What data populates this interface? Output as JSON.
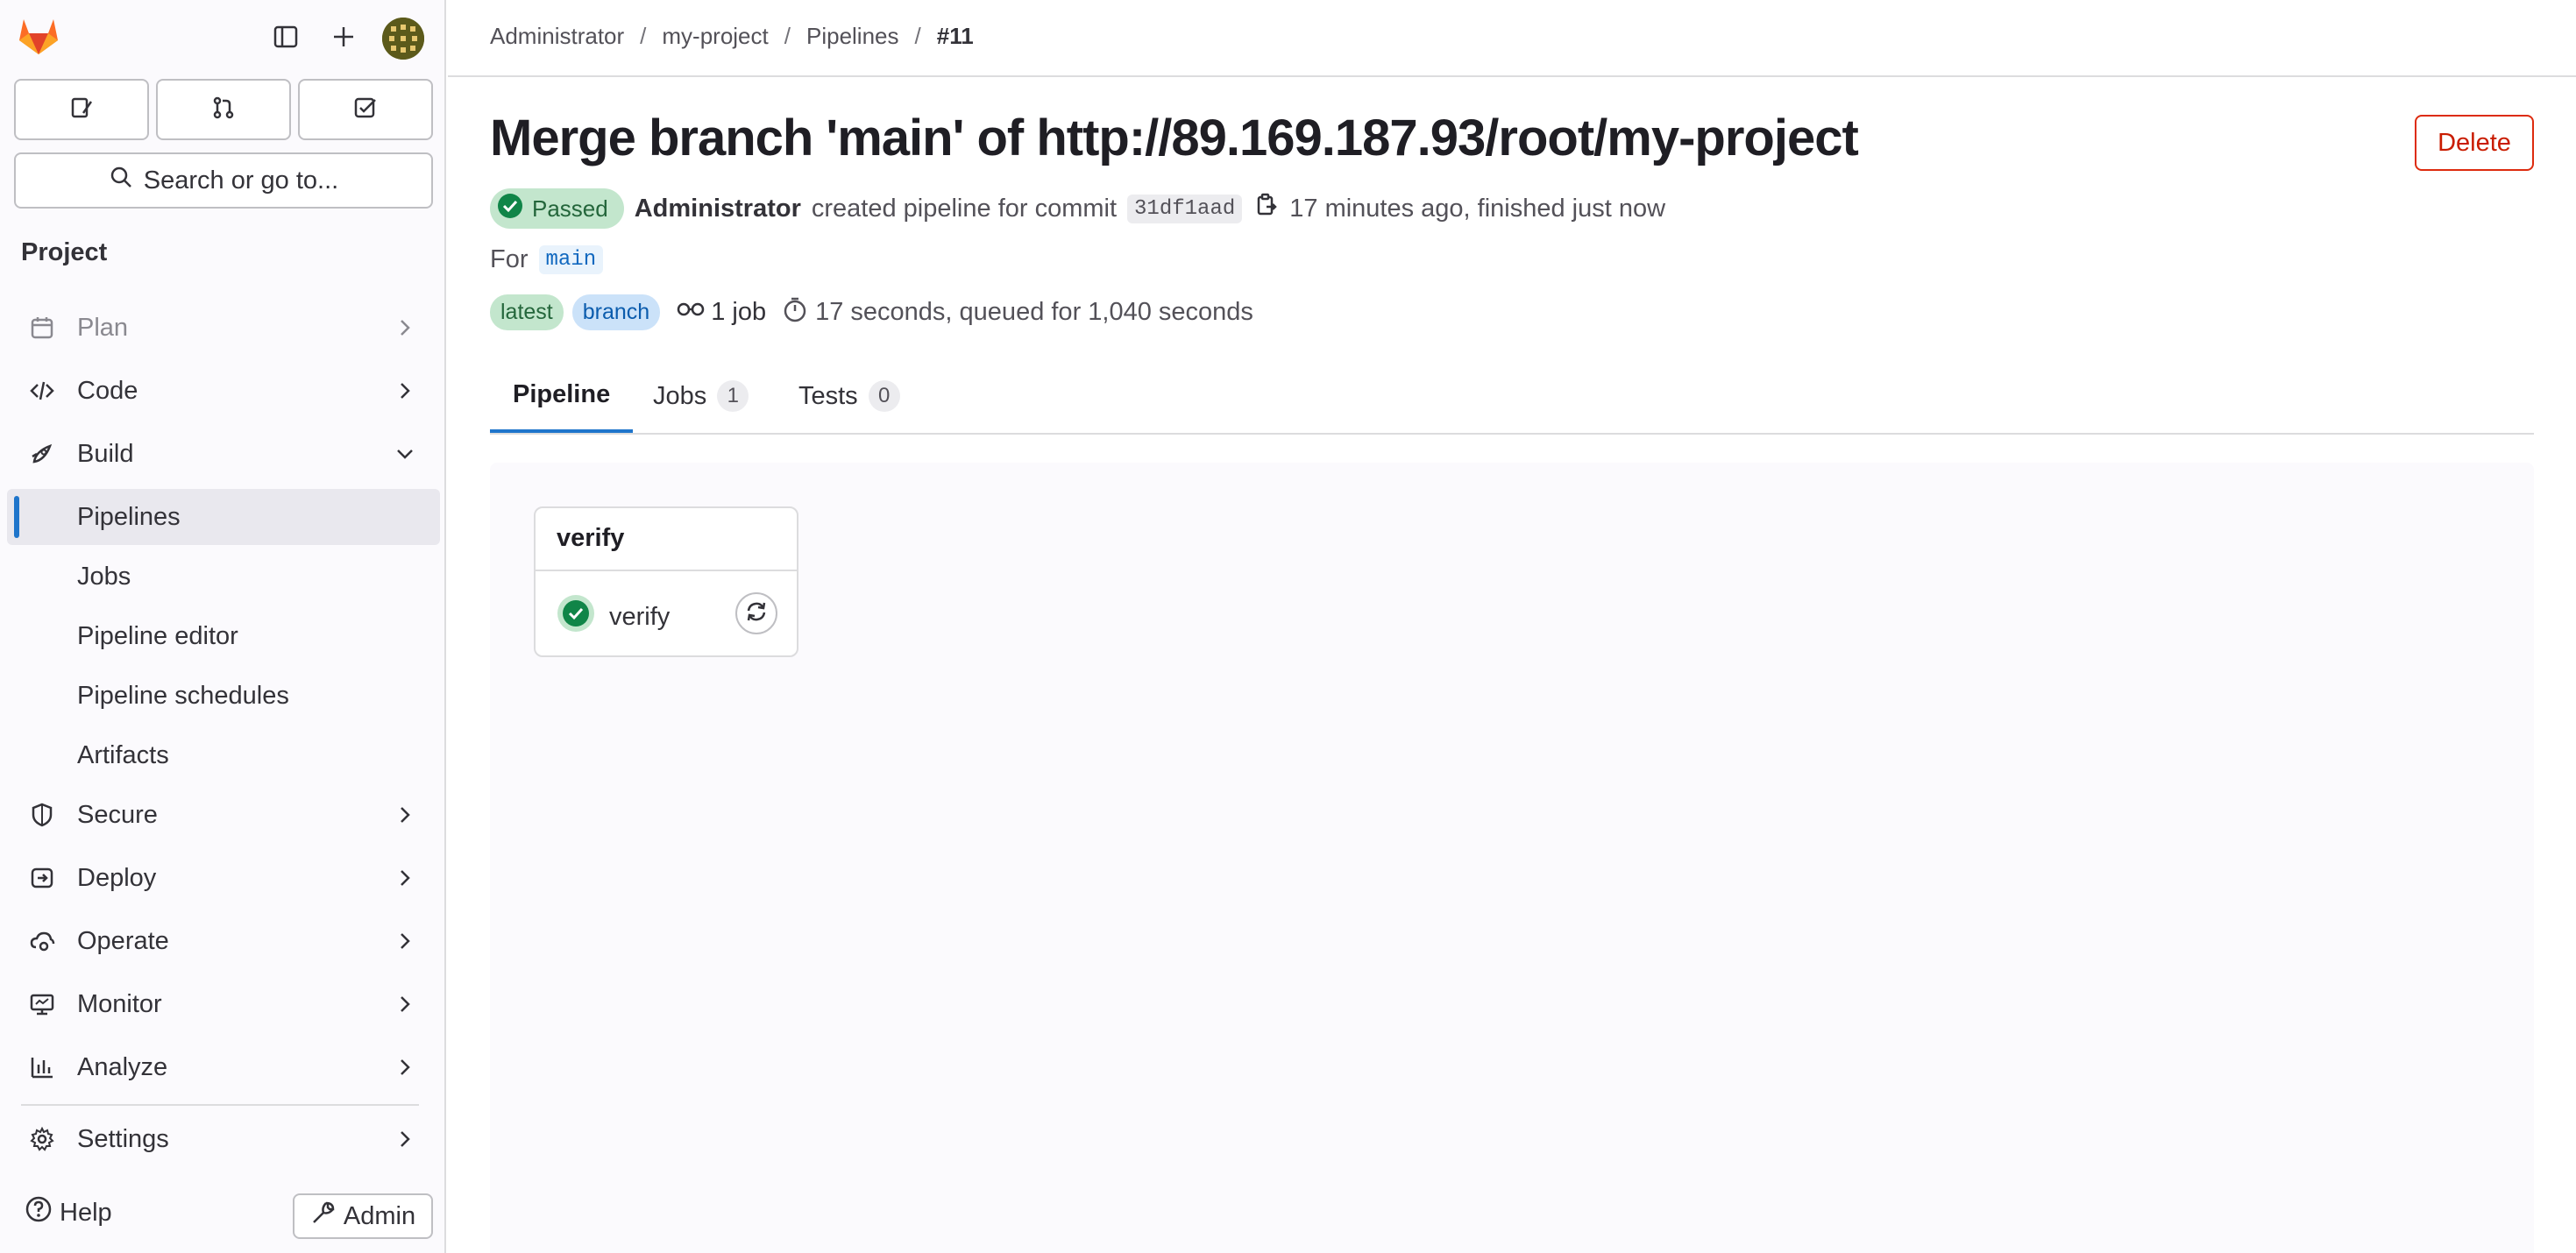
{
  "sidebar": {
    "search_label": "Search or go to...",
    "section_title": "Project",
    "nav": {
      "plan": "Plan",
      "code": "Code",
      "build": "Build",
      "secure": "Secure",
      "deploy": "Deploy",
      "operate": "Operate",
      "monitor": "Monitor",
      "analyze": "Analyze",
      "settings": "Settings"
    },
    "build_items": {
      "pipelines": "Pipelines",
      "jobs": "Jobs",
      "pipeline_editor": "Pipeline editor",
      "pipeline_schedules": "Pipeline schedules",
      "artifacts": "Artifacts"
    },
    "help_label": "Help",
    "admin_label": "Admin"
  },
  "breadcrumb": {
    "items": [
      "Administrator",
      "my-project",
      "Pipelines",
      "#11"
    ],
    "separator": "/"
  },
  "header": {
    "title": "Merge branch 'main' of http://89.169.187.93/root/my-project",
    "delete_label": "Delete"
  },
  "pipeline": {
    "status": "Passed",
    "author": "Administrator",
    "action_text": "created pipeline for commit",
    "commit_sha": "31df1aad",
    "timing": "17 minutes ago, finished just now",
    "for_label": "For",
    "ref": "main",
    "badge_latest": "latest",
    "badge_branch": "branch",
    "job_count": "1 job",
    "duration": "17 seconds, queued for 1,040 seconds"
  },
  "tabs": {
    "pipeline": "Pipeline",
    "jobs": "Jobs",
    "jobs_count": "1",
    "tests": "Tests",
    "tests_count": "0"
  },
  "graph": {
    "stage_name": "verify",
    "job_name": "verify",
    "job_status": "passed"
  },
  "colors": {
    "accent": "#1f75cb",
    "success": "#108548",
    "danger": "#dd2b0e",
    "logo_orange": "#fc6d26"
  },
  "icons": {
    "sidebar_toggle": "sidebar-toggle-icon",
    "new": "plus-icon",
    "issues": "issues-icon",
    "merge_requests": "merge-request-icon",
    "todos": "todo-icon",
    "search": "search-icon",
    "copy": "copy-icon",
    "retry": "retry-icon"
  }
}
